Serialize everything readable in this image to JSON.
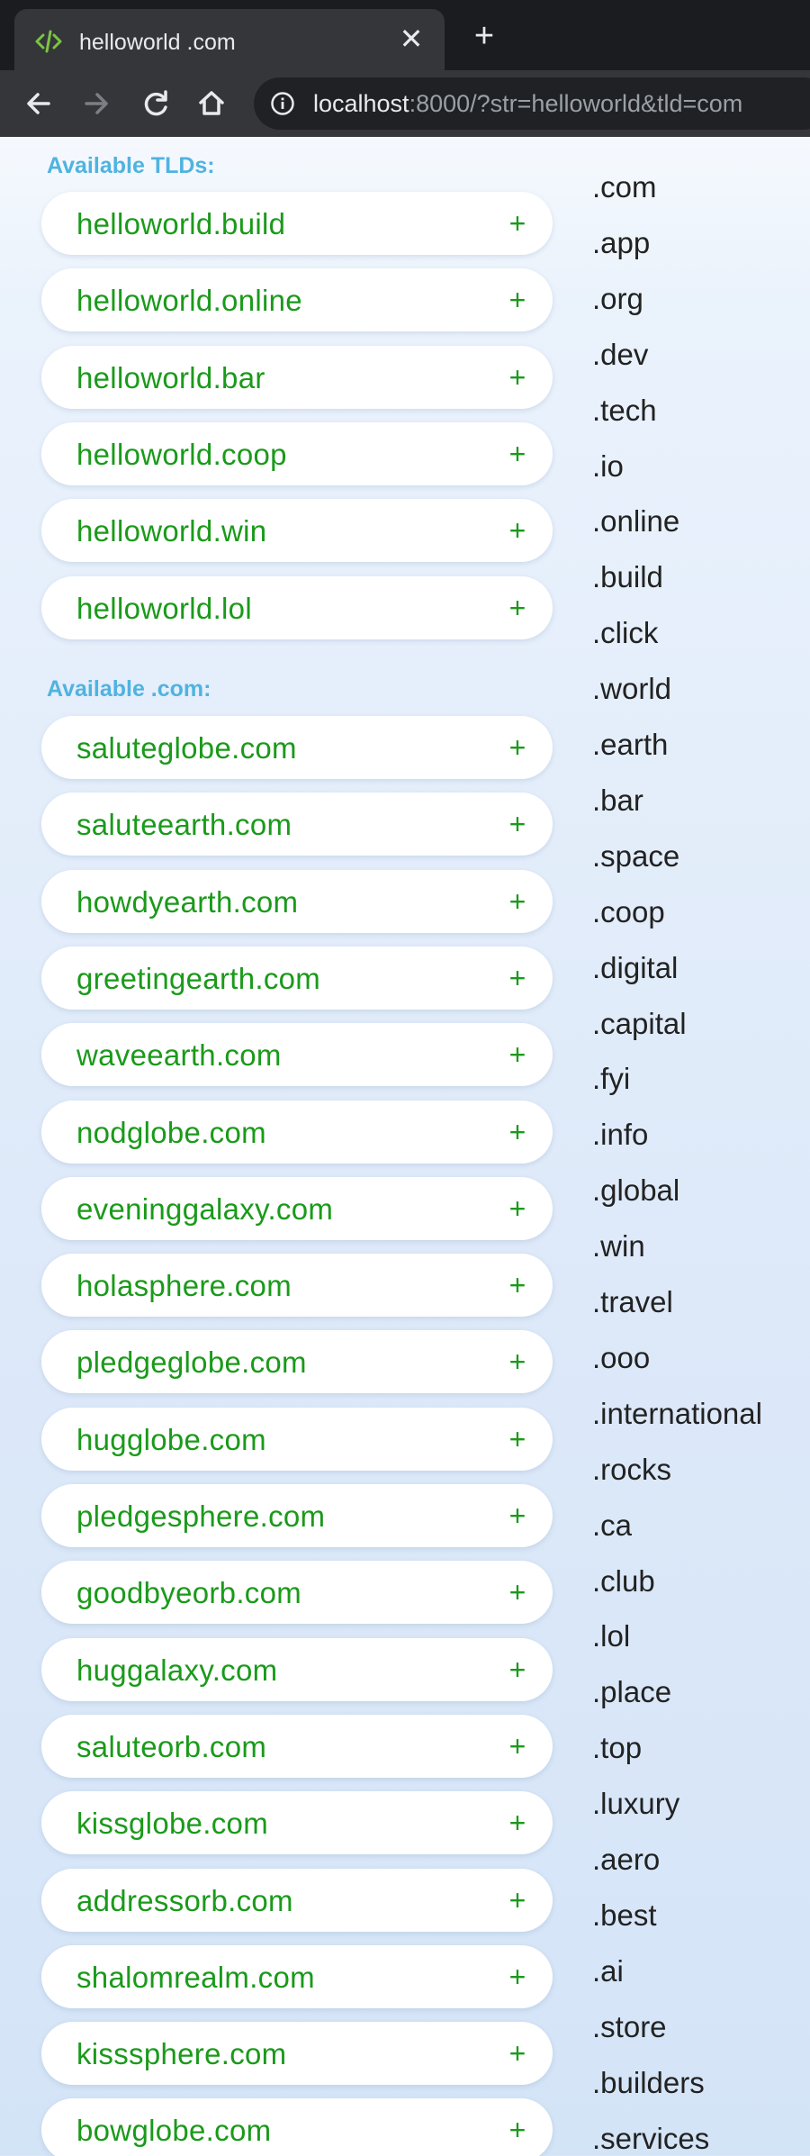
{
  "browser": {
    "tab_title": "helloworld .com",
    "url_host": "localhost",
    "url_rest": ":8000/?str=helloworld&tld=com"
  },
  "available_tlds": {
    "label": "Available TLDs:",
    "items": [
      "helloworld.build",
      "helloworld.online",
      "helloworld.bar",
      "helloworld.coop",
      "helloworld.win",
      "helloworld.lol"
    ]
  },
  "available_com": {
    "label": "Available .com:",
    "items": [
      "saluteglobe.com",
      "saluteearth.com",
      "howdyearth.com",
      "greetingearth.com",
      "waveearth.com",
      "nodglobe.com",
      "eveninggalaxy.com",
      "holasphere.com",
      "pledgeglobe.com",
      "hugglobe.com",
      "pledgesphere.com",
      "goodbyeorb.com",
      "huggalaxy.com",
      "saluteorb.com",
      "kissglobe.com",
      "addressorb.com",
      "shalomrealm.com",
      "kisssphere.com",
      "bowglobe.com"
    ]
  },
  "plus_label": "+",
  "tld_list": [
    ".com",
    ".app",
    ".org",
    ".dev",
    ".tech",
    ".io",
    ".online",
    ".build",
    ".click",
    ".world",
    ".earth",
    ".bar",
    ".space",
    ".coop",
    ".digital",
    ".capital",
    ".fyi",
    ".info",
    ".global",
    ".win",
    ".travel",
    ".ooo",
    ".international",
    ".rocks",
    ".ca",
    ".club",
    ".lol",
    ".place",
    ".top",
    ".luxury",
    ".aero",
    ".best",
    ".ai",
    ".store",
    ".builders",
    ".services"
  ],
  "icons": {
    "favicon": "code-icon",
    "close": "close-icon",
    "new_tab": "plus-icon",
    "back": "arrow-left-icon",
    "forward": "arrow-right-icon",
    "reload": "reload-icon",
    "home": "home-icon",
    "info": "info-icon"
  },
  "colors": {
    "domain_green": "#1a9a1a",
    "section_blue": "#4fb3e0",
    "chrome_dark": "#202124"
  }
}
